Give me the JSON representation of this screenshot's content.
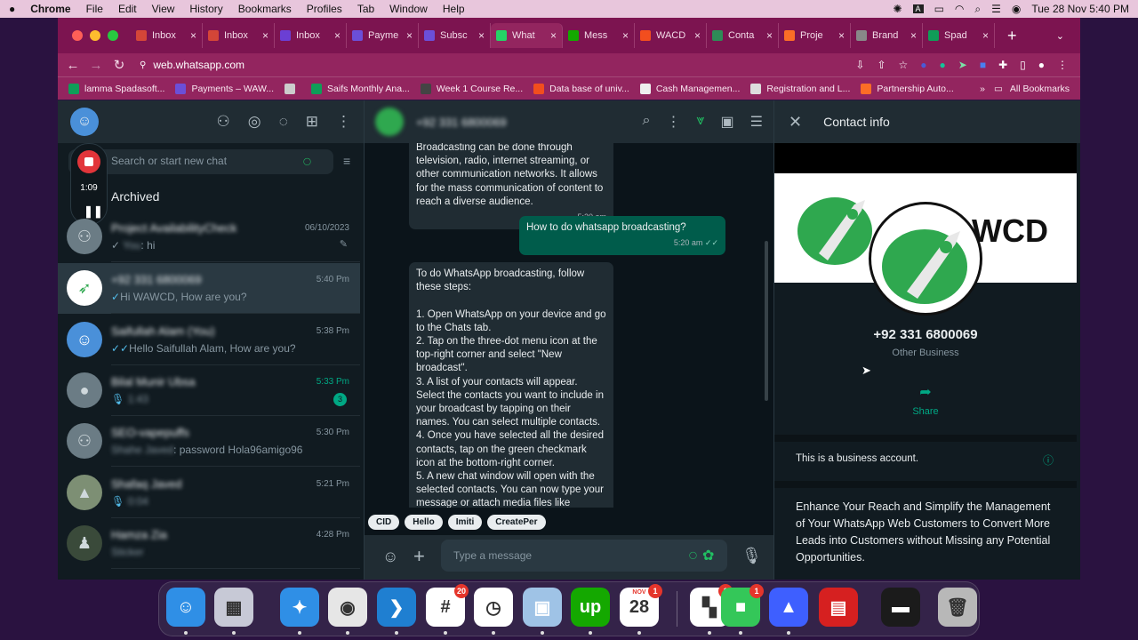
{
  "menubar": {
    "app": "Chrome",
    "items": [
      "File",
      "Edit",
      "View",
      "History",
      "Bookmarks",
      "Profiles",
      "Tab",
      "Window",
      "Help"
    ],
    "clock": "Tue 28 Nov  5:40 PM"
  },
  "tabs": [
    {
      "label": "Inbox",
      "color": "#d44638",
      "icon": "gmail-icon"
    },
    {
      "label": "Inbox",
      "color": "#d44638",
      "icon": "gmail-icon"
    },
    {
      "label": "Inbox",
      "color": "#6b3fd4",
      "icon": "helpdesk-icon"
    },
    {
      "label": "Payme",
      "color": "#6b4fd8",
      "icon": "s-icon"
    },
    {
      "label": "Subsc",
      "color": "#6b4fd8",
      "icon": "s-icon"
    },
    {
      "label": "What",
      "color": "#25d366",
      "icon": "whatsapp-icon"
    },
    {
      "label": "Mess",
      "color": "#14a800",
      "icon": "upwork-icon"
    },
    {
      "label": "WACD",
      "color": "#f24e1e",
      "icon": "figma-icon"
    },
    {
      "label": "Conta",
      "color": "#2e8b57",
      "icon": "contact-icon"
    },
    {
      "label": "Proje",
      "color": "#fc6d26",
      "icon": "gitlab-icon"
    },
    {
      "label": "Brand",
      "color": "#888888",
      "icon": "brand-icon"
    },
    {
      "label": "Spad",
      "color": "#0f9d58",
      "icon": "sheets-icon"
    }
  ],
  "address": {
    "url": "web.whatsapp.com"
  },
  "bookmarks": [
    {
      "label": "lamma Spadasoft...",
      "color": "#0f9d58"
    },
    {
      "label": "Payments – WAW...",
      "color": "#6b4fd8"
    },
    {
      "label": "",
      "color": "#cccccc"
    },
    {
      "label": "Saifs Monthly Ana...",
      "color": "#0f9d58"
    },
    {
      "label": "Week 1 Course Re...",
      "color": "#444444"
    },
    {
      "label": "Data base of univ...",
      "color": "#f24e1e"
    },
    {
      "label": "Cash Managemen...",
      "color": "#eeeeee"
    },
    {
      "label": "Registration and L...",
      "color": "#dddddd"
    },
    {
      "label": "Partnership Auto...",
      "color": "#fc6d26"
    }
  ],
  "bookmarks_all": "All Bookmarks",
  "left": {
    "search_placeholder": "Search or start new chat",
    "archived": "Archived",
    "recorder_time": "1:09",
    "chats": [
      {
        "name": "Project AvailabilityCheck",
        "preview_blur": "You",
        "preview": ": hi",
        "time": "06/10/2023",
        "group": true,
        "pinned": true
      },
      {
        "name": "+92 331 6800069",
        "preview": "Hi WAWCD, How are you?",
        "time": "5:40 Pm",
        "selected": true
      },
      {
        "name": "Saifullah Alam (You)",
        "preview": "Hello Saifullah Alam, How are you?",
        "time": "5:38 Pm"
      },
      {
        "name": "Bilal Munir Ubsa",
        "preview_blur": "1:43",
        "preview": "",
        "time": "5:33 Pm",
        "unread": "3",
        "mic": true
      },
      {
        "name": "SEO-vapepuffs",
        "preview_blur": "Shahe Javed",
        "preview": ": password Hola96amigo96",
        "time": "5:30 Pm",
        "group": true
      },
      {
        "name": "Shafaq Javed",
        "preview_blur": "0:04",
        "preview": "",
        "time": "5:21 Pm",
        "mic": true
      },
      {
        "name": "Hamza Zia",
        "preview_blur": "Sticker",
        "preview": "",
        "time": "4:28 Pm"
      }
    ]
  },
  "chat": {
    "contact": "+92 331 6800069",
    "messages": [
      {
        "dir": "in",
        "text": "Broadcasting can be done through television, radio, internet streaming, or other communication networks. It allows for the mass communication of content to reach a diverse audience.",
        "time": "5:20 am"
      },
      {
        "dir": "out",
        "text": "How to do whatsapp broadcasting?",
        "time": "5:20 am"
      },
      {
        "dir": "in",
        "text": "To do WhatsApp broadcasting, follow these steps:\n\n1. Open WhatsApp on your device and go to the Chats tab.\n2. Tap on the three-dot menu icon at the top-right corner and select \"New broadcast\".\n3. A list of your contacts will appear. Select the contacts you want to include in your broadcast by tapping on their names. You can select multiple contacts.\n4. Once you have selected all the desired contacts, tap on the green checkmark icon at the bottom-right corner.\n5. A new chat window will open with the selected contacts. You can now type your message or attach media files like"
      }
    ],
    "chips": [
      "CID",
      "Hello",
      "Imiti",
      "CreatePer"
    ],
    "input_placeholder": "Type a message"
  },
  "contact_info": {
    "title": "Contact info",
    "banner_text": "WCD",
    "phone": "+92 331 6800069",
    "type": "Other Business",
    "share": "Share",
    "business_note": "This is a business account.",
    "about": "Enhance Your Reach and Simplify the Management of Your WhatsApp Web Customers to Convert More Leads into Customers without Missing any Potential Opportunities."
  },
  "dock": [
    {
      "name": "finder",
      "color": "#2f8fe6",
      "glyph": "☺"
    },
    {
      "name": "launchpad",
      "color": "#c7c9d6",
      "glyph": "▦"
    },
    {
      "name": "safari",
      "color": "#2f8fe6",
      "glyph": "✦"
    },
    {
      "name": "chrome",
      "color": "#e6e6e6",
      "glyph": "◉"
    },
    {
      "name": "vscode",
      "color": "#1f7fd1",
      "glyph": "❯"
    },
    {
      "name": "slack",
      "color": "#ffffff",
      "glyph": "#",
      "badge": "20"
    },
    {
      "name": "clock",
      "color": "#ffffff",
      "glyph": "◷"
    },
    {
      "name": "preview",
      "color": "#9fc3e6",
      "glyph": "▣"
    },
    {
      "name": "upwork",
      "color": "#14a800",
      "glyph": "up"
    },
    {
      "name": "calendar",
      "color": "#ffffff",
      "glyph": "28",
      "badge": "1",
      "month": "NOV"
    },
    {
      "name": "office",
      "color": "#ffffff",
      "glyph": "▚",
      "badge": "1"
    },
    {
      "name": "facetime",
      "color": "#34c759",
      "glyph": "■",
      "badge": "1"
    },
    {
      "name": "nordvpn",
      "color": "#3e5fff",
      "glyph": "▲"
    },
    {
      "name": "photo-booth",
      "color": "#d62020",
      "glyph": "▤"
    },
    {
      "name": "window",
      "color": "#1b1b1b",
      "glyph": "▬"
    },
    {
      "name": "trash",
      "color": "#b8b8b8",
      "glyph": "🗑"
    }
  ]
}
